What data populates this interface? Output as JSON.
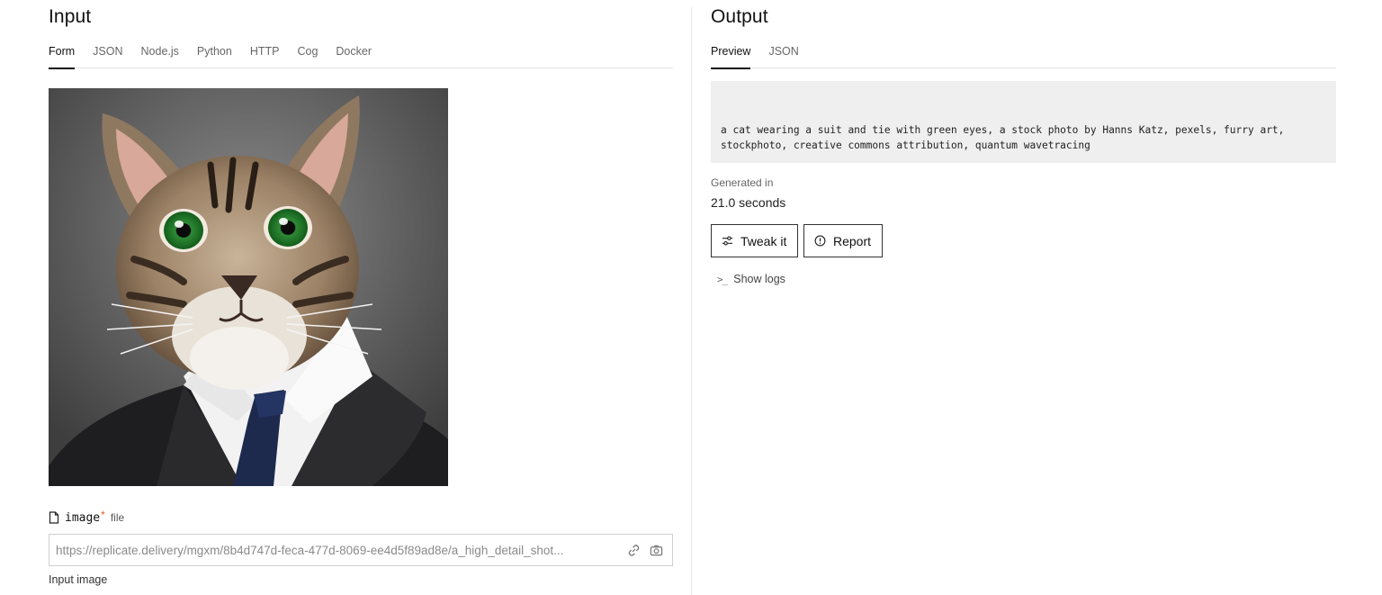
{
  "input": {
    "title": "Input",
    "tabs": [
      "Form",
      "JSON",
      "Node.js",
      "Python",
      "HTTP",
      "Cog",
      "Docker"
    ],
    "active_tab": "Form",
    "field": {
      "name": "image",
      "required_mark": "*",
      "type": "file",
      "value": "https://replicate.delivery/mgxm/8b4d747d-feca-477d-8069-ee4d5f89ad8e/a_high_detail_shot...",
      "help": "Input image",
      "icons": [
        "file-icon",
        "link-icon",
        "camera-icon"
      ]
    },
    "image_preview": {
      "alt": "cat wearing a suit and tie"
    }
  },
  "output": {
    "title": "Output",
    "tabs": [
      "Preview",
      "JSON"
    ],
    "active_tab": "Preview",
    "text": "a cat wearing a suit and tie with green eyes, a stock photo by Hanns Katz, pexels, furry art, stockphoto, creative commons attribution, quantum wavetracing",
    "generated_label": "Generated in",
    "generated_value": "21.0 seconds",
    "buttons": {
      "tweak": "Tweak it",
      "report": "Report"
    },
    "show_logs": "Show logs"
  },
  "colors": {
    "required": "#e25b2d",
    "output_bg": "#efefef",
    "border": "#cfcfcf"
  }
}
